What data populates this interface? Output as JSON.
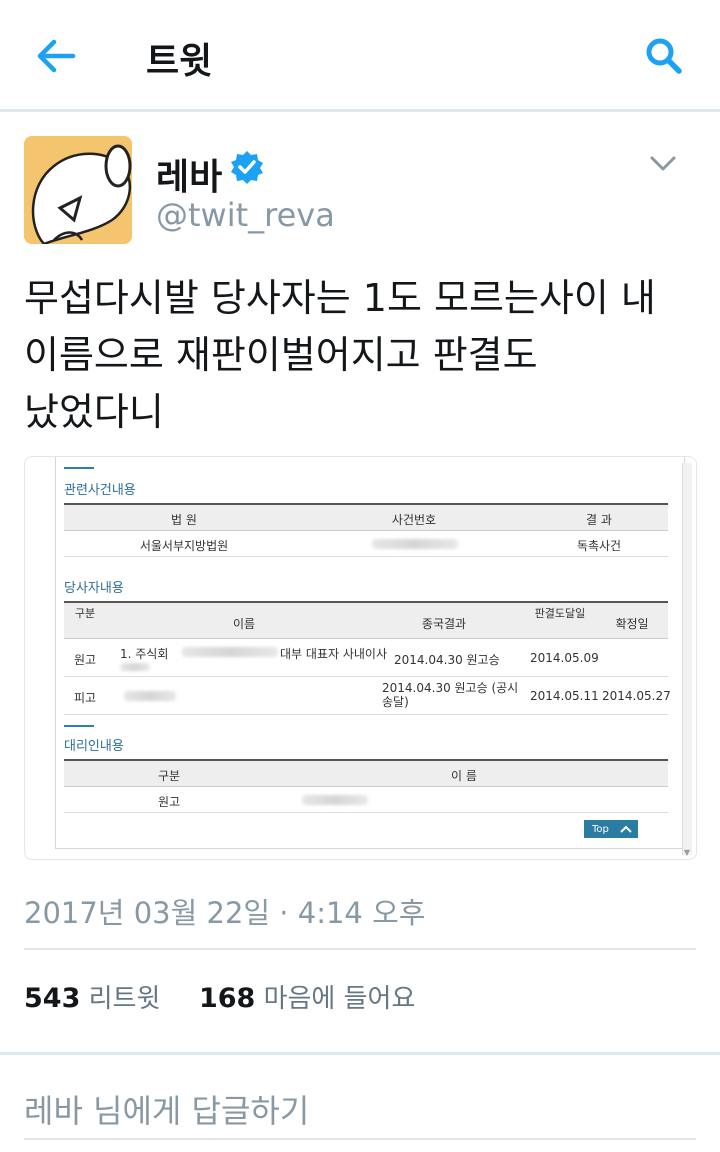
{
  "header": {
    "title": "트윗"
  },
  "author": {
    "name": "레바",
    "handle": "@twit_reva"
  },
  "tweet": {
    "lines": [
      "무섭다시발 당사자는 1도 모르는사이 내",
      "이름으로 재판이벌어지고 판결도",
      "났었다니"
    ]
  },
  "media": {
    "related_case": {
      "title": "관련사건내용",
      "headers": [
        "법 원",
        "사건번호",
        "결 과"
      ],
      "row": {
        "court": "서울서부지방법원",
        "result": "독촉사건"
      }
    },
    "parties": {
      "title": "당사자내용",
      "headers": [
        "구분",
        "이름",
        "종국결과",
        "판결도달일",
        "확정일"
      ],
      "rows": [
        {
          "type": "원고",
          "name_prefix": "1. 주식회",
          "name_suffix": "대부 대표자 사내이사",
          "result": "2014.04.30 원고승",
          "delivery": "2014.05.09",
          "final": ""
        },
        {
          "type": "피고",
          "name_prefix": "",
          "name_suffix": "",
          "result": "2014.04.30 원고승 (공시송달)",
          "delivery": "2014.05.11",
          "final": "2014.05.27"
        }
      ]
    },
    "agent": {
      "title": "대리인내용",
      "headers": [
        "구분",
        "이 름"
      ],
      "row": {
        "type": "원고"
      }
    },
    "top_button": "Top"
  },
  "meta": {
    "timestamp": "2017년 03월 22일 · 4:14 오후"
  },
  "stats": {
    "retweets": "543",
    "retweets_label": "리트윗",
    "likes": "168",
    "likes_label": "마음에 들어요"
  },
  "reply": {
    "placeholder": "레바 님에게 답글하기"
  },
  "colors": {
    "accent": "#1da1f2",
    "muted": "#8899a6",
    "verified": "#1da1f2",
    "table_title": "#2f6e9f"
  }
}
